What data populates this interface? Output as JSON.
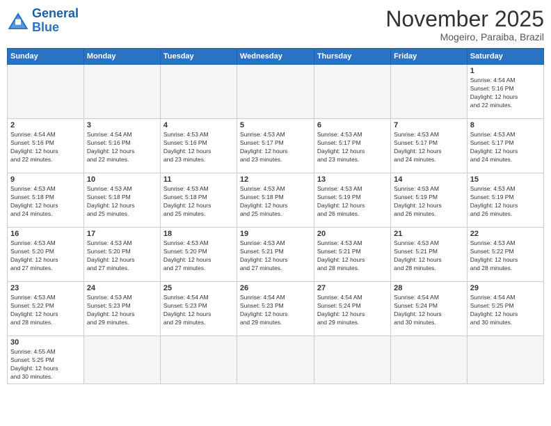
{
  "logo": {
    "line1": "General",
    "line2": "Blue"
  },
  "title": "November 2025",
  "location": "Mogeiro, Paraiba, Brazil",
  "weekdays": [
    "Sunday",
    "Monday",
    "Tuesday",
    "Wednesday",
    "Thursday",
    "Friday",
    "Saturday"
  ],
  "weeks": [
    [
      {
        "day": "",
        "info": ""
      },
      {
        "day": "",
        "info": ""
      },
      {
        "day": "",
        "info": ""
      },
      {
        "day": "",
        "info": ""
      },
      {
        "day": "",
        "info": ""
      },
      {
        "day": "",
        "info": ""
      },
      {
        "day": "1",
        "info": "Sunrise: 4:54 AM\nSunset: 5:16 PM\nDaylight: 12 hours\nand 22 minutes."
      }
    ],
    [
      {
        "day": "2",
        "info": "Sunrise: 4:54 AM\nSunset: 5:16 PM\nDaylight: 12 hours\nand 22 minutes."
      },
      {
        "day": "3",
        "info": "Sunrise: 4:54 AM\nSunset: 5:16 PM\nDaylight: 12 hours\nand 22 minutes."
      },
      {
        "day": "4",
        "info": "Sunrise: 4:53 AM\nSunset: 5:16 PM\nDaylight: 12 hours\nand 23 minutes."
      },
      {
        "day": "5",
        "info": "Sunrise: 4:53 AM\nSunset: 5:17 PM\nDaylight: 12 hours\nand 23 minutes."
      },
      {
        "day": "6",
        "info": "Sunrise: 4:53 AM\nSunset: 5:17 PM\nDaylight: 12 hours\nand 23 minutes."
      },
      {
        "day": "7",
        "info": "Sunrise: 4:53 AM\nSunset: 5:17 PM\nDaylight: 12 hours\nand 24 minutes."
      },
      {
        "day": "8",
        "info": "Sunrise: 4:53 AM\nSunset: 5:17 PM\nDaylight: 12 hours\nand 24 minutes."
      }
    ],
    [
      {
        "day": "9",
        "info": "Sunrise: 4:53 AM\nSunset: 5:18 PM\nDaylight: 12 hours\nand 24 minutes."
      },
      {
        "day": "10",
        "info": "Sunrise: 4:53 AM\nSunset: 5:18 PM\nDaylight: 12 hours\nand 25 minutes."
      },
      {
        "day": "11",
        "info": "Sunrise: 4:53 AM\nSunset: 5:18 PM\nDaylight: 12 hours\nand 25 minutes."
      },
      {
        "day": "12",
        "info": "Sunrise: 4:53 AM\nSunset: 5:18 PM\nDaylight: 12 hours\nand 25 minutes."
      },
      {
        "day": "13",
        "info": "Sunrise: 4:53 AM\nSunset: 5:19 PM\nDaylight: 12 hours\nand 26 minutes."
      },
      {
        "day": "14",
        "info": "Sunrise: 4:53 AM\nSunset: 5:19 PM\nDaylight: 12 hours\nand 26 minutes."
      },
      {
        "day": "15",
        "info": "Sunrise: 4:53 AM\nSunset: 5:19 PM\nDaylight: 12 hours\nand 26 minutes."
      }
    ],
    [
      {
        "day": "16",
        "info": "Sunrise: 4:53 AM\nSunset: 5:20 PM\nDaylight: 12 hours\nand 27 minutes."
      },
      {
        "day": "17",
        "info": "Sunrise: 4:53 AM\nSunset: 5:20 PM\nDaylight: 12 hours\nand 27 minutes."
      },
      {
        "day": "18",
        "info": "Sunrise: 4:53 AM\nSunset: 5:20 PM\nDaylight: 12 hours\nand 27 minutes."
      },
      {
        "day": "19",
        "info": "Sunrise: 4:53 AM\nSunset: 5:21 PM\nDaylight: 12 hours\nand 27 minutes."
      },
      {
        "day": "20",
        "info": "Sunrise: 4:53 AM\nSunset: 5:21 PM\nDaylight: 12 hours\nand 28 minutes."
      },
      {
        "day": "21",
        "info": "Sunrise: 4:53 AM\nSunset: 5:21 PM\nDaylight: 12 hours\nand 28 minutes."
      },
      {
        "day": "22",
        "info": "Sunrise: 4:53 AM\nSunset: 5:22 PM\nDaylight: 12 hours\nand 28 minutes."
      }
    ],
    [
      {
        "day": "23",
        "info": "Sunrise: 4:53 AM\nSunset: 5:22 PM\nDaylight: 12 hours\nand 28 minutes."
      },
      {
        "day": "24",
        "info": "Sunrise: 4:53 AM\nSunset: 5:23 PM\nDaylight: 12 hours\nand 29 minutes."
      },
      {
        "day": "25",
        "info": "Sunrise: 4:54 AM\nSunset: 5:23 PM\nDaylight: 12 hours\nand 29 minutes."
      },
      {
        "day": "26",
        "info": "Sunrise: 4:54 AM\nSunset: 5:23 PM\nDaylight: 12 hours\nand 29 minutes."
      },
      {
        "day": "27",
        "info": "Sunrise: 4:54 AM\nSunset: 5:24 PM\nDaylight: 12 hours\nand 29 minutes."
      },
      {
        "day": "28",
        "info": "Sunrise: 4:54 AM\nSunset: 5:24 PM\nDaylight: 12 hours\nand 30 minutes."
      },
      {
        "day": "29",
        "info": "Sunrise: 4:54 AM\nSunset: 5:25 PM\nDaylight: 12 hours\nand 30 minutes."
      }
    ],
    [
      {
        "day": "30",
        "info": "Sunrise: 4:55 AM\nSunset: 5:25 PM\nDaylight: 12 hours\nand 30 minutes."
      },
      {
        "day": "",
        "info": ""
      },
      {
        "day": "",
        "info": ""
      },
      {
        "day": "",
        "info": ""
      },
      {
        "day": "",
        "info": ""
      },
      {
        "day": "",
        "info": ""
      },
      {
        "day": "",
        "info": ""
      }
    ]
  ]
}
